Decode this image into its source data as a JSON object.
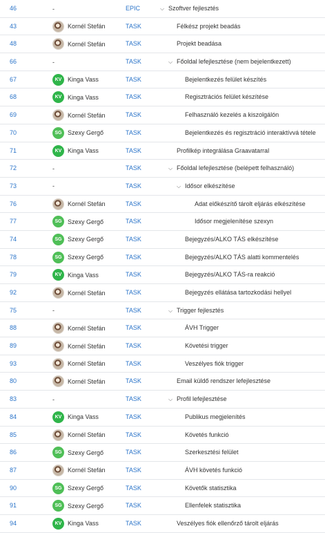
{
  "rows": [
    {
      "id": "46",
      "assignee": "-",
      "avatar": "none",
      "type": "EPIC",
      "chevron": true,
      "level": 0,
      "title": "Szoftver fejlesztés"
    },
    {
      "id": "43",
      "assignee": "Kornél Stefán",
      "avatar": "photo",
      "type": "TASK",
      "chevron": false,
      "level": 1,
      "title": "Félkész projekt beadás"
    },
    {
      "id": "48",
      "assignee": "Kornél Stefán",
      "avatar": "photo",
      "type": "TASK",
      "chevron": false,
      "level": 1,
      "title": "Projekt beadása"
    },
    {
      "id": "66",
      "assignee": "-",
      "avatar": "none",
      "type": "TASK",
      "chevron": true,
      "level": 1,
      "title": "Főoldal lefejlesztése (nem bejelentkezett)"
    },
    {
      "id": "67",
      "assignee": "Kinga Vass",
      "avatar": "kv",
      "type": "TASK",
      "chevron": false,
      "level": 2,
      "title": "Bejelentkezés felület készítés"
    },
    {
      "id": "68",
      "assignee": "Kinga Vass",
      "avatar": "kv",
      "type": "TASK",
      "chevron": false,
      "level": 2,
      "title": "Regisztrációs felület készítése"
    },
    {
      "id": "69",
      "assignee": "Kornél Stefán",
      "avatar": "photo",
      "type": "TASK",
      "chevron": false,
      "level": 2,
      "title": "Felhasználó kezelés a kiszolgálón"
    },
    {
      "id": "70",
      "assignee": "Szexy Gergő",
      "avatar": "sg",
      "type": "TASK",
      "chevron": false,
      "level": 2,
      "title": "Bejelentkezés és regisztráció interaktívvá tétele"
    },
    {
      "id": "71",
      "assignee": "Kinga Vass",
      "avatar": "kv",
      "type": "TASK",
      "chevron": false,
      "level": 1,
      "title": "Profilkép integrálása Graavatarral"
    },
    {
      "id": "72",
      "assignee": "-",
      "avatar": "none",
      "type": "TASK",
      "chevron": true,
      "level": 1,
      "title": "Főoldal lefejlesztése (belépett felhasználó)"
    },
    {
      "id": "73",
      "assignee": "-",
      "avatar": "none",
      "type": "TASK",
      "chevron": true,
      "level": 2,
      "title": "Idősor elkészítése"
    },
    {
      "id": "76",
      "assignee": "Kornél Stefán",
      "avatar": "photo",
      "type": "TASK",
      "chevron": false,
      "level": 3,
      "title": "Adat előkészítő tárolt eljárás elkészítése"
    },
    {
      "id": "77",
      "assignee": "Szexy Gergő",
      "avatar": "sg",
      "type": "TASK",
      "chevron": false,
      "level": 3,
      "title": "Idősor megjelenítése szexyn"
    },
    {
      "id": "74",
      "assignee": "Szexy Gergő",
      "avatar": "sg",
      "type": "TASK",
      "chevron": false,
      "level": 2,
      "title": "Bejegyzés/ALKO TÁS elkészítése"
    },
    {
      "id": "78",
      "assignee": "Szexy Gergő",
      "avatar": "sg",
      "type": "TASK",
      "chevron": false,
      "level": 2,
      "title": "Bejegyzés/ALKO TÁS alatti kommentelés"
    },
    {
      "id": "79",
      "assignee": "Kinga Vass",
      "avatar": "kv",
      "type": "TASK",
      "chevron": false,
      "level": 2,
      "title": "Bejegyzés/ALKO TÁS-ra reakció"
    },
    {
      "id": "92",
      "assignee": "Kornél Stefán",
      "avatar": "photo",
      "type": "TASK",
      "chevron": false,
      "level": 2,
      "title": "Bejegyzés ellátása tartozkodási hellyel"
    },
    {
      "id": "75",
      "assignee": "-",
      "avatar": "none",
      "type": "TASK",
      "chevron": true,
      "level": 1,
      "title": "Trigger fejlesztés"
    },
    {
      "id": "88",
      "assignee": "Kornél Stefán",
      "avatar": "photo",
      "type": "TASK",
      "chevron": false,
      "level": 2,
      "title": "ÁVH Trigger"
    },
    {
      "id": "89",
      "assignee": "Kornél Stefán",
      "avatar": "photo",
      "type": "TASK",
      "chevron": false,
      "level": 2,
      "title": "Követési trigger"
    },
    {
      "id": "93",
      "assignee": "Kornél Stefán",
      "avatar": "photo",
      "type": "TASK",
      "chevron": false,
      "level": 2,
      "title": "Veszélyes fiók trigger"
    },
    {
      "id": "80",
      "assignee": "Kornél Stefán",
      "avatar": "photo",
      "type": "TASK",
      "chevron": false,
      "level": 1,
      "title": "Email küldő rendszer lefejlesztése"
    },
    {
      "id": "83",
      "assignee": "-",
      "avatar": "none",
      "type": "TASK",
      "chevron": true,
      "level": 1,
      "title": "Profil lefejlesztése"
    },
    {
      "id": "84",
      "assignee": "Kinga Vass",
      "avatar": "kv",
      "type": "TASK",
      "chevron": false,
      "level": 2,
      "title": "Publikus megjelenítés"
    },
    {
      "id": "85",
      "assignee": "Kornél Stefán",
      "avatar": "photo",
      "type": "TASK",
      "chevron": false,
      "level": 2,
      "title": "Követés funkció"
    },
    {
      "id": "86",
      "assignee": "Szexy Gergő",
      "avatar": "sg",
      "type": "TASK",
      "chevron": false,
      "level": 2,
      "title": "Szerkesztési felület"
    },
    {
      "id": "87",
      "assignee": "Kornél Stefán",
      "avatar": "photo",
      "type": "TASK",
      "chevron": false,
      "level": 2,
      "title": "ÁVH követés funkció"
    },
    {
      "id": "90",
      "assignee": "Szexy Gergő",
      "avatar": "sg",
      "type": "TASK",
      "chevron": false,
      "level": 2,
      "title": "Követők statisztika"
    },
    {
      "id": "91",
      "assignee": "Szexy Gergő",
      "avatar": "sg",
      "type": "TASK",
      "chevron": false,
      "level": 2,
      "title": "Ellenfelek statisztika"
    },
    {
      "id": "94",
      "assignee": "Kinga Vass",
      "avatar": "kv",
      "type": "TASK",
      "chevron": false,
      "level": 1,
      "title": "Veszélyes fiók ellenőrző tárolt eljárás"
    }
  ],
  "avatar_initials": {
    "kv": "KV",
    "sg": "SG"
  },
  "colors": {
    "link": "#2b74c9",
    "kv": "#2fb54a",
    "sg": "#4fbf57",
    "divider": "#e4e6ea"
  }
}
